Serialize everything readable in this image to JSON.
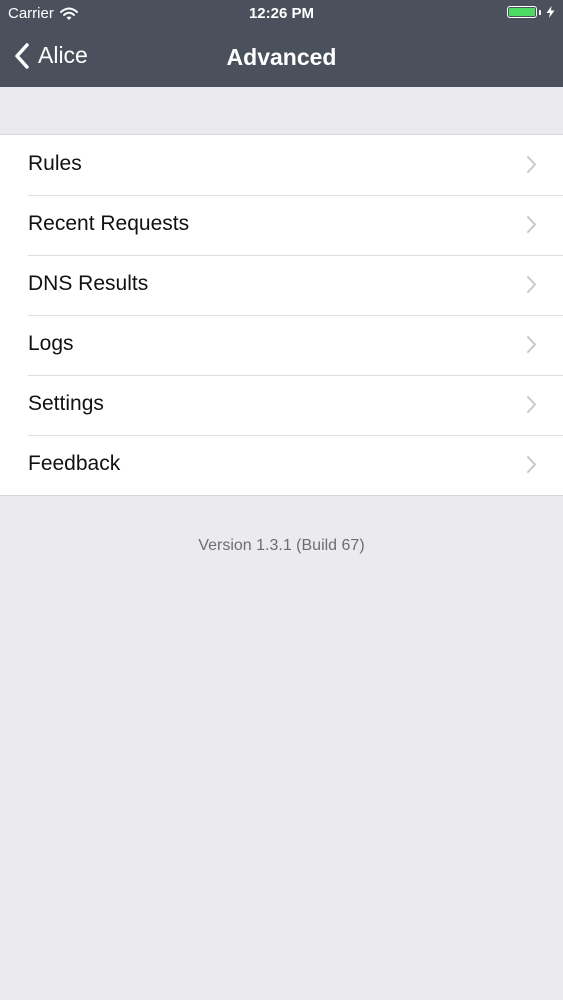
{
  "status_bar": {
    "carrier": "Carrier",
    "time": "12:26 PM",
    "battery_level": 1.0,
    "battery_color": "#4cd964",
    "icons": [
      "wifi-icon",
      "battery-icon",
      "charging-bolt-icon"
    ]
  },
  "nav": {
    "back_label": "Alice",
    "title": "Advanced",
    "background_color": "#4a515c"
  },
  "menu": {
    "items": [
      {
        "label": "Rules"
      },
      {
        "label": "Recent Requests"
      },
      {
        "label": "DNS Results"
      },
      {
        "label": "Logs"
      },
      {
        "label": "Settings"
      },
      {
        "label": "Feedback"
      }
    ]
  },
  "footer": {
    "version": "Version 1.3.1 (Build 67)"
  }
}
